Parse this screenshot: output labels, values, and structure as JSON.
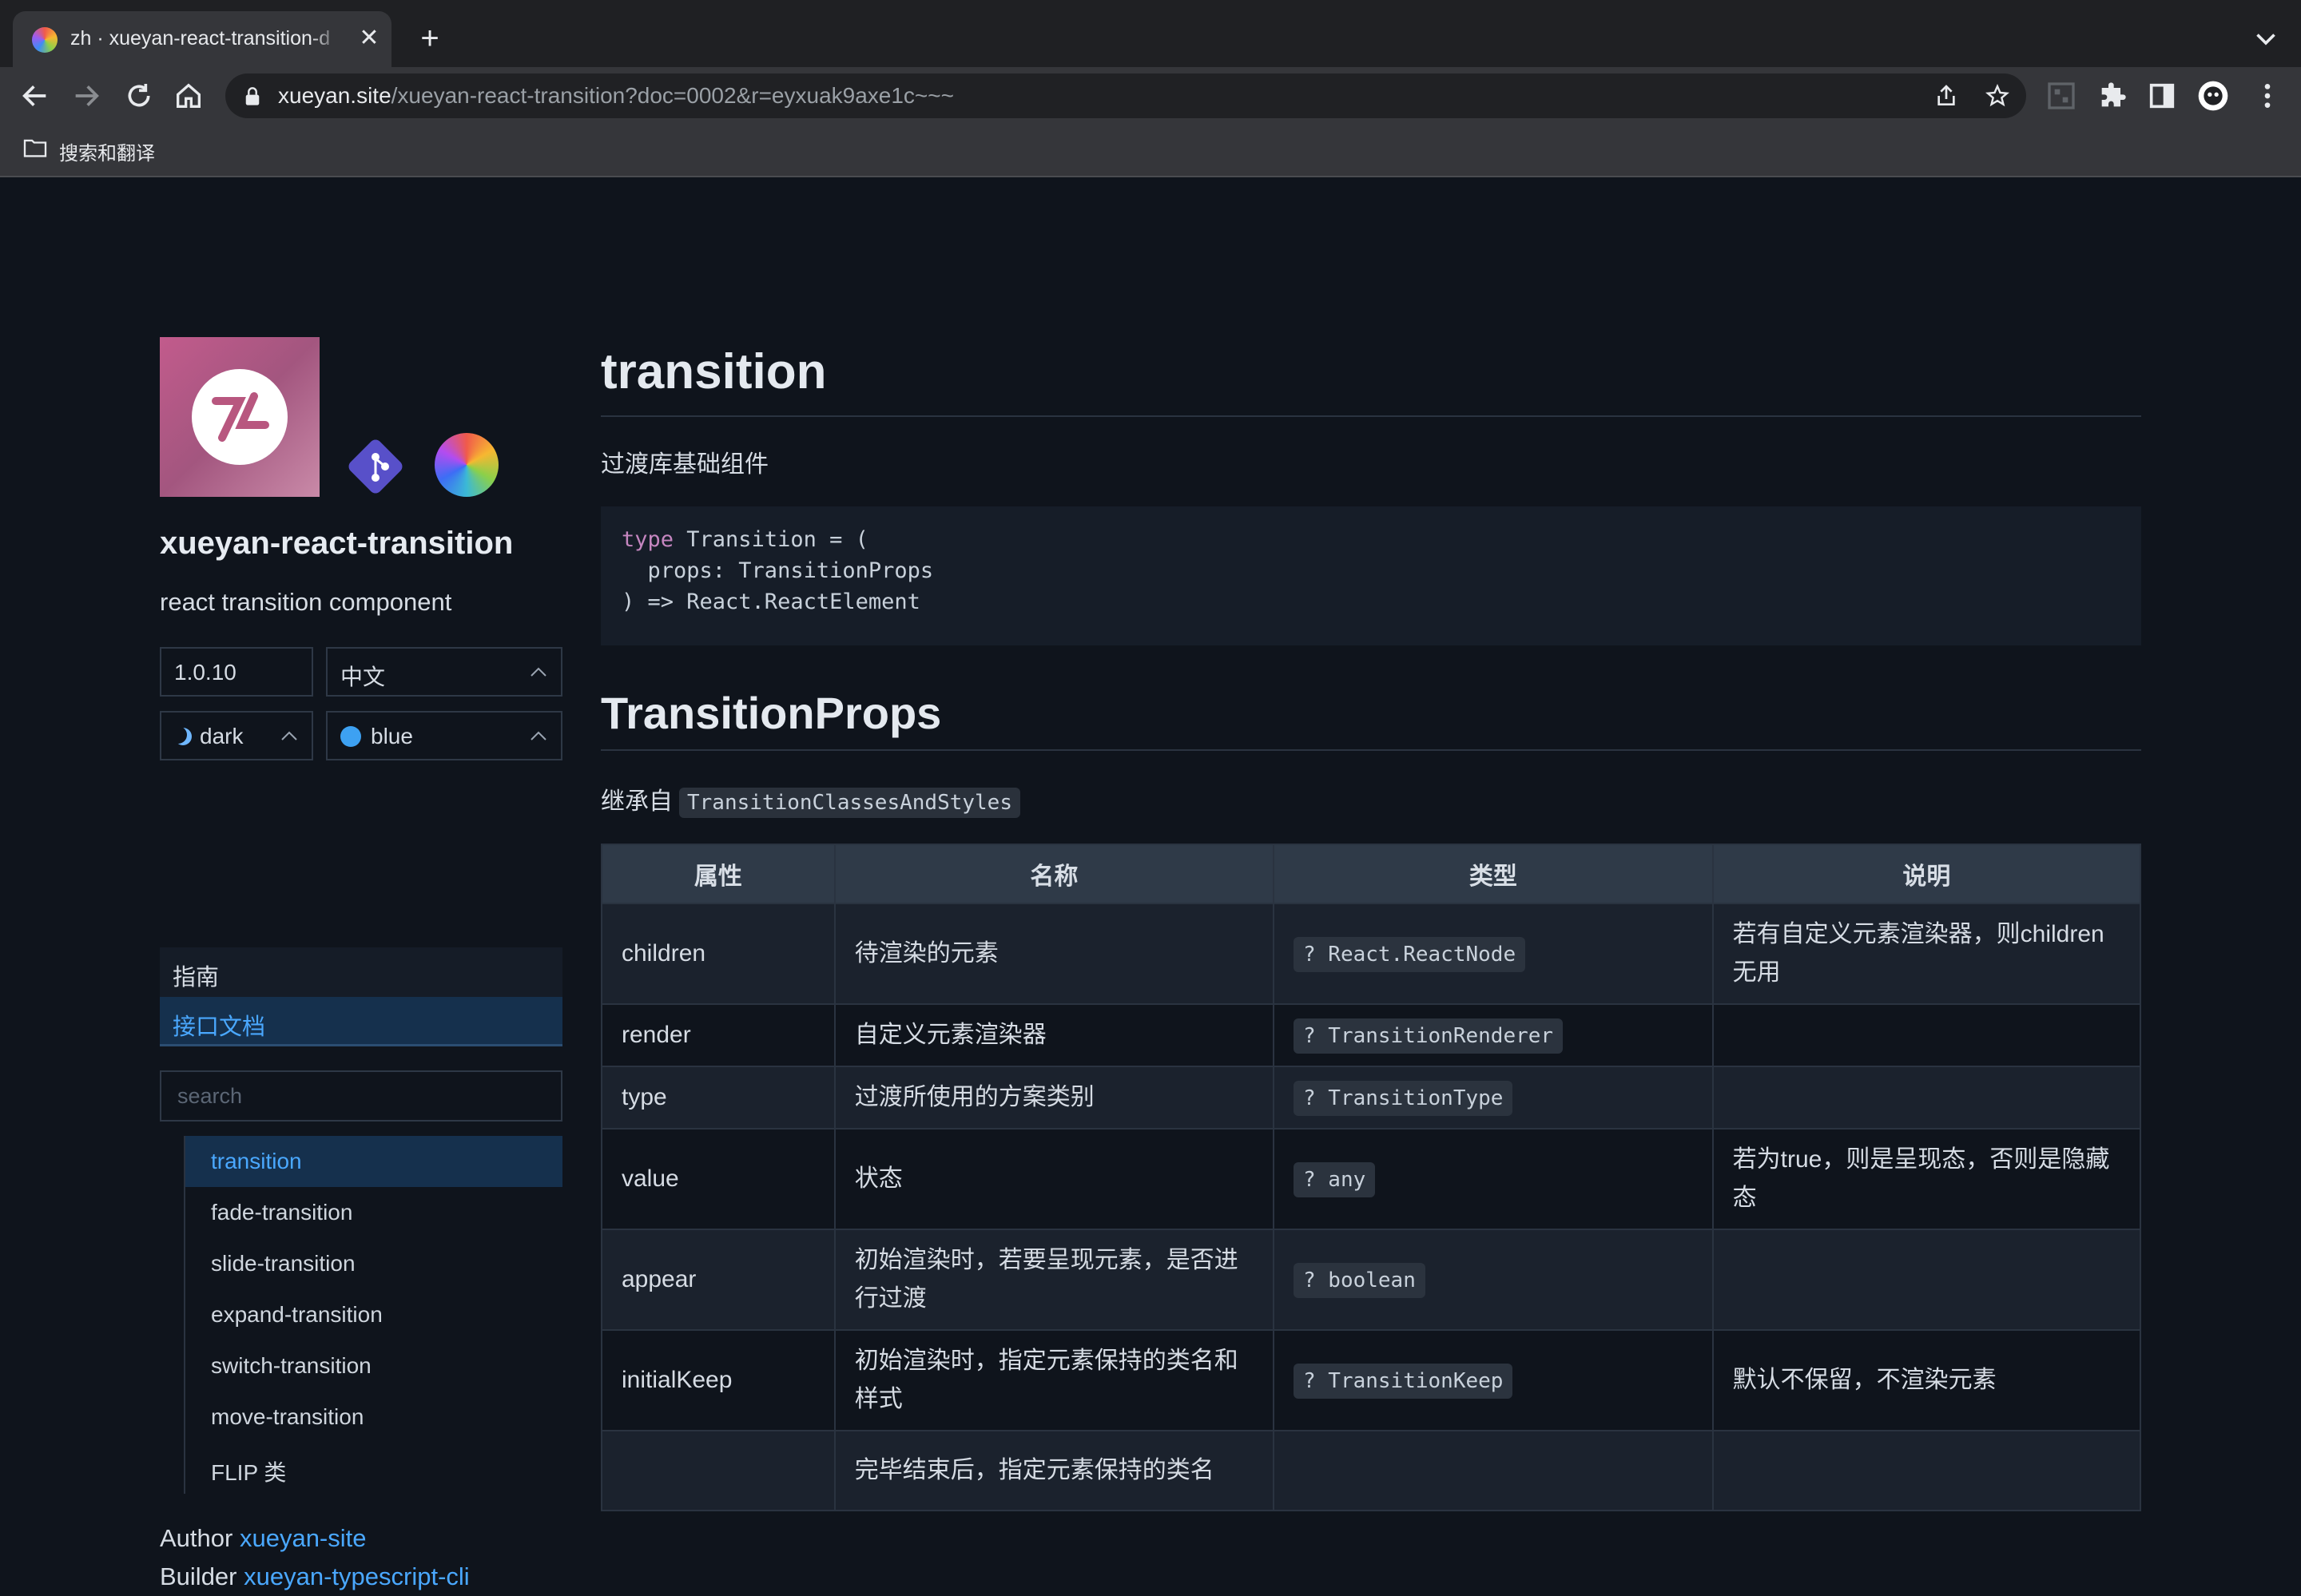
{
  "browser": {
    "tab_title": "zh · xueyan-react-transition-d",
    "tab_close": "✕",
    "new_tab": "+",
    "url_host": "xueyan.site",
    "url_path": "/xueyan-react-transition?doc=0002&r=eyxuak9axe1c~~~",
    "bookmark_label": "搜索和翻译"
  },
  "sidebar": {
    "site_name": "xueyan-react-transition",
    "site_desc": "react transition component",
    "version": "1.0.10",
    "language": "中文",
    "theme": "dark",
    "color": "blue",
    "nav_guide": "指南",
    "nav_api": "接口文档",
    "search_placeholder": "search",
    "docs": [
      "transition",
      "fade-transition",
      "slide-transition",
      "expand-transition",
      "switch-transition",
      "move-transition",
      "FLIP 类"
    ],
    "author_label": "Author",
    "author_value": "xueyan-site",
    "builder_label": "Builder",
    "builder_value": "xueyan-typescript-cli"
  },
  "main": {
    "title": "transition",
    "intro": "过渡库基础组件",
    "code_lines": [
      {
        "kw": "type",
        "rest": " Transition = ("
      },
      {
        "kw": "",
        "rest": "  props: TransitionProps"
      },
      {
        "kw": "",
        "rest": ") => React.ReactElement"
      }
    ],
    "props_title": "TransitionProps",
    "inherit_label": "继承自",
    "inherit_code": "TransitionClassesAndStyles",
    "table": {
      "headers": [
        "属性",
        "名称",
        "类型",
        "说明"
      ],
      "rows": [
        {
          "prop": "children",
          "name": "待渲染的元素",
          "type": "? React.ReactNode",
          "desc": "若有自定义元素渲染器，则children 无用"
        },
        {
          "prop": "render",
          "name": "自定义元素渲染器",
          "type": "? TransitionRenderer",
          "desc": ""
        },
        {
          "prop": "type",
          "name": "过渡所使用的方案类别",
          "type": "? TransitionType",
          "desc": ""
        },
        {
          "prop": "value",
          "name": "状态",
          "type": "? any",
          "desc": "若为true，则是呈现态，否则是隐藏态"
        },
        {
          "prop": "appear",
          "name": "初始渲染时，若要呈现元素，是否进行过渡",
          "type": "? boolean",
          "desc": ""
        },
        {
          "prop": "initialKeep",
          "name": "初始渲染时，指定元素保持的类名和样式",
          "type": "? TransitionKeep",
          "desc": "默认不保留，不渲染元素"
        },
        {
          "prop": "",
          "name": "完毕结束后，指定元素保持的类名",
          "type": "",
          "desc": ""
        }
      ]
    }
  },
  "colors": {
    "accent": "#4aa8ff",
    "page_bg": "#0f141c",
    "table_header_bg": "#2f3a48"
  }
}
